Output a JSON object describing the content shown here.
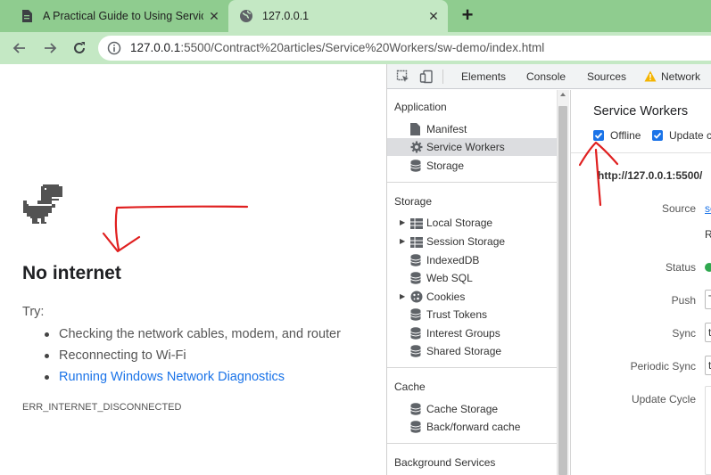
{
  "browser": {
    "tabs": [
      {
        "title": "A Practical Guide to Using Servic",
        "icon": "document-icon",
        "active": false
      },
      {
        "title": "127.0.0.1",
        "icon": "globe-icon",
        "active": true
      }
    ],
    "new_tab": "+",
    "url_host": "127.0.0.1",
    "url_rest": ":5500/Contract%20articles/Service%20Workers/sw-demo/index.html",
    "close_glyph": "✕"
  },
  "page": {
    "headline": "No internet",
    "try_label": "Try:",
    "suggestions": [
      "Checking the network cables, modem, and router",
      "Reconnecting to Wi-Fi",
      "Running Windows Network Diagnostics"
    ],
    "error_code": "ERR_INTERNET_DISCONNECTED"
  },
  "devtools": {
    "tabs": [
      "Elements",
      "Console",
      "Sources",
      "Network"
    ],
    "sidebar": {
      "application": {
        "heading": "Application",
        "items": [
          "Manifest",
          "Service Workers",
          "Storage"
        ]
      },
      "storage": {
        "heading": "Storage",
        "items": [
          "Local Storage",
          "Session Storage",
          "IndexedDB",
          "Web SQL",
          "Cookies",
          "Trust Tokens",
          "Interest Groups",
          "Shared Storage"
        ]
      },
      "cache": {
        "heading": "Cache",
        "items": [
          "Cache Storage",
          "Back/forward cache"
        ]
      },
      "background": {
        "heading": "Background Services"
      }
    },
    "main": {
      "title": "Service Workers",
      "offline_label": "Offline",
      "update_label": "Update c",
      "worker_url": "http://127.0.0.1:5500/",
      "rows": {
        "source": "Source",
        "source_value": "sc",
        "received_value": "R",
        "status": "Status",
        "push": "Push",
        "push_value": "T",
        "sync": "Sync",
        "sync_value": "t",
        "periodic_sync": "Periodic Sync",
        "periodic_sync_value": "t",
        "update_cycle": "Update Cycle"
      }
    }
  },
  "colors": {
    "tabstrip": "#8fcc8f",
    "toolbar": "#c4e8c4",
    "link": "#1a73e8",
    "annotation": "#e02020",
    "status_green": "#2fa84f"
  }
}
